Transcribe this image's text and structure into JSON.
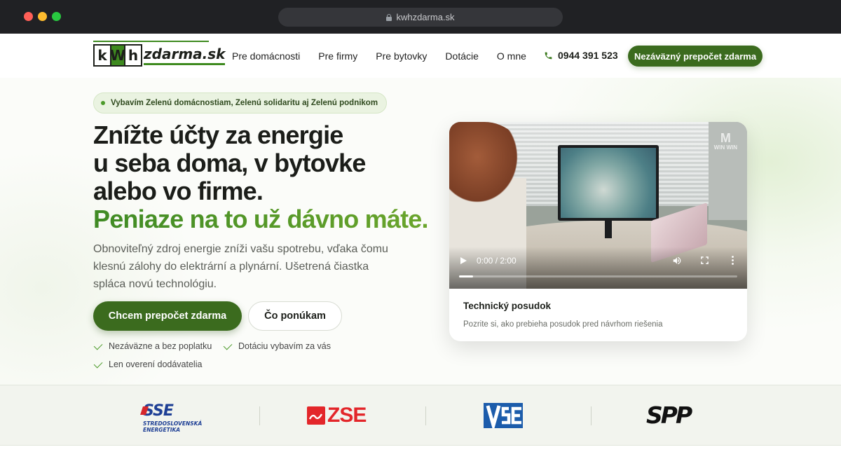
{
  "browser": {
    "url": "kwhzdarma.sk"
  },
  "header": {
    "logo": {
      "letters": [
        "k",
        "W",
        "h"
      ],
      "text": "zdarma.sk"
    },
    "nav": [
      {
        "label": "Pre domácnosti"
      },
      {
        "label": "Pre firmy"
      },
      {
        "label": "Pre bytovky"
      },
      {
        "label": "Dotácie"
      },
      {
        "label": "O mne"
      }
    ],
    "phone": "0944 391 523",
    "cta_label": "Nezáväzný prepočet zdarma"
  },
  "hero": {
    "badge": "Vybavím Zelenú domácnostiam, Zelenú solidaritu aj Zelenú podnikom",
    "headline_lines": [
      "Znížte účty za energie",
      "u seba doma, v bytovke",
      "alebo vo firme."
    ],
    "headline_green": "Peniaze na to už dávno máte.",
    "lead": "Obnoviteľný zdroj energie zníži vašu spotrebu, vďaka čomu klesnú zálohy do elektrární a plynární. Ušetrená čiastka spláca novú technológiu.",
    "primary_button": "Chcem prepočet zdarma",
    "secondary_button": "Čo ponúkam",
    "checks": [
      "Nezáväzne a bez poplatku",
      "Dotáciu vybavím za vás",
      "Len overení dodávatelia"
    ]
  },
  "video_card": {
    "time": "0:00 / 2:00",
    "progress": 0.05,
    "watermark": "WIN WIN",
    "title": "Technický posudok",
    "subtitle": "Pozrite si, ako prebieha posudok pred návrhom riešenia"
  },
  "partners": {
    "sse": {
      "mark": "SSE",
      "sub_1": "STREDOSLOVENSKÁ",
      "sub_2": "ENERGETIKA"
    },
    "zse": {
      "text": "ZSE"
    },
    "vse": {
      "name": "VSE"
    },
    "spp": {
      "text": "SPP"
    }
  },
  "colors": {
    "brand_green": "#3b6b1e",
    "accent_green": "#4c9a2a",
    "sse_blue": "#1e3f95",
    "zse_red": "#e3262a",
    "vse_blue": "#1c5cab"
  },
  "icons": [
    "lock-icon",
    "phone-icon",
    "check-icon",
    "play-icon",
    "volume-icon",
    "fullscreen-icon",
    "more-vertical-icon"
  ]
}
